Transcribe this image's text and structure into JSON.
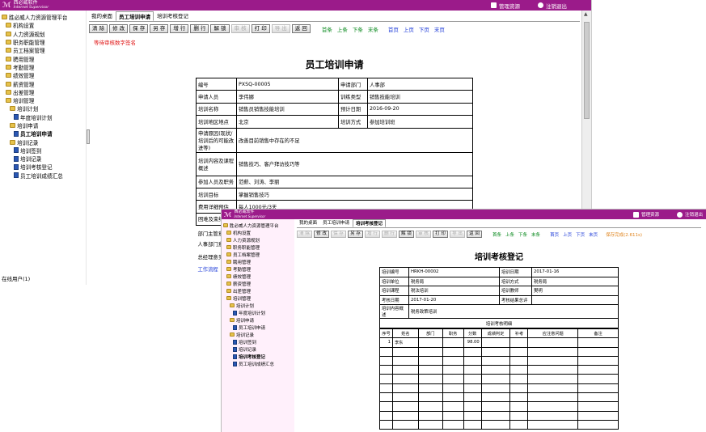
{
  "brand": {
    "logo_glyph": "ℳ",
    "name": "西必威软件",
    "tagline": "Internet Supervisor"
  },
  "topbar": {
    "manage": "管理资源",
    "logout": "注销退出"
  },
  "tree": [
    {
      "label": "胜必威人力资源管理平台",
      "level": 0,
      "icon": "folder-icon"
    },
    {
      "label": "机构设置",
      "level": 1,
      "icon": "folder-icon"
    },
    {
      "label": "人力资源规划",
      "level": 1,
      "icon": "folder-icon"
    },
    {
      "label": "职务职能管理",
      "level": 1,
      "icon": "folder-icon"
    },
    {
      "label": "员工档案管理",
      "level": 1,
      "icon": "folder-icon"
    },
    {
      "label": "聘用管理",
      "level": 1,
      "icon": "folder-icon"
    },
    {
      "label": "考勤管理",
      "level": 1,
      "icon": "folder-icon"
    },
    {
      "label": "绩效管理",
      "level": 1,
      "icon": "folder-icon"
    },
    {
      "label": "薪资管理",
      "level": 1,
      "icon": "folder-icon"
    },
    {
      "label": "出差管理",
      "level": 1,
      "icon": "folder-icon"
    },
    {
      "label": "培训管理",
      "level": 1,
      "icon": "folder-icon"
    },
    {
      "label": "培训计划",
      "level": 2,
      "icon": "folder-icon"
    },
    {
      "label": "年度培训计划",
      "level": 3,
      "icon": "page-icon"
    },
    {
      "label": "培训申请",
      "level": 2,
      "icon": "folder-icon"
    },
    {
      "label": "员工培训申请",
      "level": 3,
      "icon": "page-icon"
    },
    {
      "label": "培训记录",
      "level": 2,
      "icon": "folder-icon"
    },
    {
      "label": "培训签到",
      "level": 3,
      "icon": "page-icon"
    },
    {
      "label": "培训记录",
      "level": 3,
      "icon": "page-icon"
    },
    {
      "label": "培训考核登记",
      "level": 3,
      "icon": "page-icon"
    },
    {
      "label": "员工培训成绩汇总",
      "level": 3,
      "icon": "page-icon"
    }
  ],
  "sidebar_footer": "在线用户(1)",
  "win1": {
    "tabs": [
      "我的桌面",
      "员工培训申请",
      "培训考核登记"
    ],
    "toolbar": [
      {
        "label": "清 除",
        "enabled": true
      },
      {
        "label": "修 改",
        "enabled": true
      },
      {
        "label": "保 存",
        "enabled": true
      },
      {
        "label": "另 存",
        "enabled": true
      },
      {
        "label": "增 行",
        "enabled": true
      },
      {
        "label": "删 行",
        "enabled": true
      },
      {
        "label": "解 锁",
        "enabled": true
      },
      {
        "label": "审 核",
        "enabled": false
      },
      {
        "label": "打 印",
        "enabled": true
      },
      {
        "label": "导 出",
        "enabled": false
      },
      {
        "label": "返 回",
        "enabled": true
      }
    ],
    "nav": [
      {
        "label": "首条",
        "color": "g"
      },
      {
        "label": "上条",
        "color": "g"
      },
      {
        "label": "下条",
        "color": "g"
      },
      {
        "label": "末条",
        "color": "g"
      },
      {
        "label": "首页",
        "color": "b"
      },
      {
        "label": "上页",
        "color": "b"
      },
      {
        "label": "下页",
        "color": "b"
      },
      {
        "label": "末页",
        "color": "b"
      }
    ],
    "warning": "等待审核数字签名",
    "title": "员工培训申请",
    "fields": {
      "no_l": "编号",
      "no_v": "PXSQ-00005",
      "dept_l": "申请部门",
      "dept_v": "人事部",
      "applicant_l": "申请人员",
      "applicant_v": "李伟娜",
      "type_l": "训练类型",
      "type_v": "销售技能培训",
      "name_l": "培训名称",
      "name_v": "销售员销售技能培训",
      "date_l": "预计日期",
      "date_v": "2016-09-20",
      "place_l": "培训地区地点",
      "place_v": "北京",
      "mode_l": "培训方式",
      "mode_v": "参加培训班",
      "reason_l": "申请原因(现状/培训后的可能改进等)",
      "reason_v": "改善目前销售中存在的不足",
      "content_l": "培训内容及课程概述",
      "content_v": "销售技巧、客户拜访技巧等",
      "people_l": "参加人员及职务",
      "people_v": "范薪、刘涛、李丽",
      "goal_l": "培训目标",
      "goal_v": "掌握销售技巧",
      "cost_l": "费用详细预估",
      "cost_v": "每人1000元/3天",
      "diff_l": "困难及束缚",
      "diff_v": "",
      "mgr_l": "部门主管意见",
      "hr_l": "人事部门意见",
      "gm_l": "总经理意见",
      "flow_l": "工作流程"
    }
  },
  "win2": {
    "tabs": [
      "我的桌面",
      "员工培训申请",
      "培训考核登记"
    ],
    "toolbar": [
      {
        "label": "清 除",
        "enabled": false
      },
      {
        "label": "修 改",
        "enabled": true
      },
      {
        "label": "保 存",
        "enabled": false
      },
      {
        "label": "另 存",
        "enabled": true
      },
      {
        "label": "增 行",
        "enabled": false
      },
      {
        "label": "删 行",
        "enabled": false
      },
      {
        "label": "解 锁",
        "enabled": true
      },
      {
        "label": "审 核",
        "enabled": false
      },
      {
        "label": "打 印",
        "enabled": true
      },
      {
        "label": "导 出",
        "enabled": false
      },
      {
        "label": "返 回",
        "enabled": true
      }
    ],
    "nav": [
      {
        "label": "首条",
        "color": "g"
      },
      {
        "label": "上条",
        "color": "g"
      },
      {
        "label": "下条",
        "color": "g"
      },
      {
        "label": "末条",
        "color": "g"
      },
      {
        "label": "首页",
        "color": "b"
      },
      {
        "label": "上页",
        "color": "b"
      },
      {
        "label": "下页",
        "color": "b"
      },
      {
        "label": "末页",
        "color": "b"
      },
      {
        "label": "保存完成(2.611s)",
        "color": "o"
      }
    ],
    "title": "培训考核登记",
    "fields": {
      "no_l": "培训编号",
      "no_v": "HRKH-00002",
      "date_l": "培训日期",
      "date_v": "2017-01-16",
      "unit_l": "培训单位",
      "unit_v": "税务局",
      "mode_l": "培训方式",
      "mode_v": "税务局",
      "course_l": "培训课程",
      "course_v": "税法培训",
      "teacher_l": "培训教师",
      "teacher_v": "樊明",
      "exam_date_l": "考核日期",
      "exam_date_v": "2017-01-20",
      "exam_result_l": "考核结果总评",
      "exam_result_v": "",
      "content_l": "培训内容概述",
      "content_v": "税务政策培训",
      "detail_l": "培训考核明细"
    },
    "grid_headers": [
      "序号",
      "姓名",
      "部门",
      "职务",
      "分数",
      "成绩判定",
      "补考",
      "应注意问题",
      "备注"
    ],
    "grid_rows": [
      [
        "1",
        "李东",
        "",
        "",
        "98.00",
        "",
        "",
        "",
        ""
      ]
    ],
    "empty_rows": 9
  }
}
